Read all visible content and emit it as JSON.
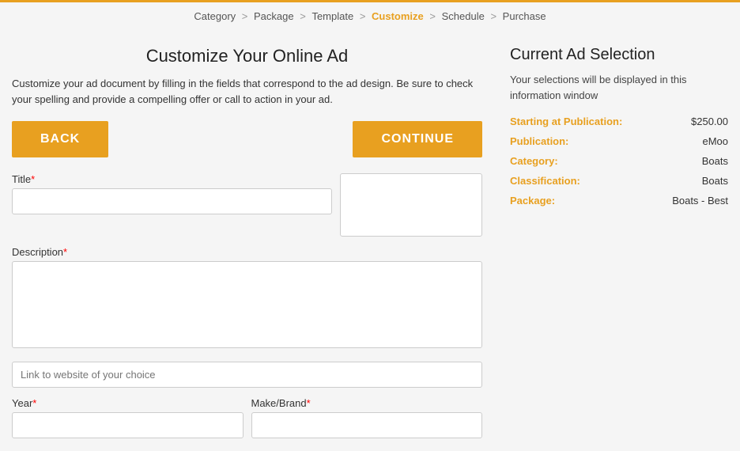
{
  "breadcrumb": {
    "items": [
      {
        "label": "Category",
        "active": false
      },
      {
        "label": "Package",
        "active": false
      },
      {
        "label": "Template",
        "active": false
      },
      {
        "label": "Customize",
        "active": true
      },
      {
        "label": "Schedule",
        "active": false
      },
      {
        "label": "Purchase",
        "active": false
      }
    ]
  },
  "page": {
    "title": "Customize Your Online Ad",
    "description": "Customize your ad document by filling in the fields that correspond to the ad design. Be sure to check your spelling and provide a compelling offer or call to action in your ad."
  },
  "buttons": {
    "back": "BACK",
    "continue": "CONTINUE"
  },
  "form": {
    "title_label": "Title",
    "description_label": "Description",
    "link_label": "Link to website of your choice",
    "year_label": "Year",
    "make_brand_label": "Make/Brand"
  },
  "sidebar": {
    "title": "Current Ad Selection",
    "description": "Your selections will be displayed in this information window",
    "items": [
      {
        "label": "Starting at Publication:",
        "value": "$250.00"
      },
      {
        "label": "Publication:",
        "value": "eMoo"
      },
      {
        "label": "Category:",
        "value": "Boats"
      },
      {
        "label": "Classification:",
        "value": "Boats"
      },
      {
        "label": "Package:",
        "value": "Boats - Best"
      }
    ]
  }
}
